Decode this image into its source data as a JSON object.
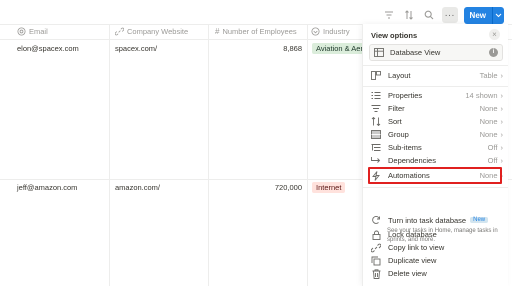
{
  "toolbar": {
    "filter_icon": "filter-icon",
    "sort_icon": "sort-icon",
    "search_icon": "search-icon",
    "more_label": "···",
    "new_label": "New"
  },
  "table": {
    "columns": [
      {
        "icon": "at-icon",
        "label": "Email"
      },
      {
        "icon": "link-icon",
        "label": "Company Website"
      },
      {
        "icon": "hash-icon",
        "label": "Number of Employees"
      },
      {
        "icon": "select-icon",
        "label": "Industry"
      }
    ],
    "rows": [
      {
        "email": "elon@spacex.com",
        "website": "spacex.com/",
        "employees": "8,868",
        "industry": "Aviation & Aeros"
      },
      {
        "email": "jeff@amazon.com",
        "website": "amazon.com/",
        "employees": "720,000",
        "industry": "Internet"
      }
    ]
  },
  "colors": {
    "accent": "#2383e2",
    "tag_green_bg": "#dbeddb",
    "tag_red_bg": "#ffe2dd",
    "highlight": "#e0201f"
  },
  "panel": {
    "title": "View options",
    "close_label": "×",
    "db_name": "Database View",
    "layout_label": "Layout",
    "layout_value": "Table",
    "items": [
      {
        "icon": "list-icon",
        "label": "Properties",
        "value": "14 shown"
      },
      {
        "icon": "filter-icon",
        "label": "Filter",
        "value": "None"
      },
      {
        "icon": "sort-icon",
        "label": "Sort",
        "value": "None"
      },
      {
        "icon": "group-icon",
        "label": "Group",
        "value": "None"
      },
      {
        "icon": "sub-items-icon",
        "label": "Sub-items",
        "value": "Off"
      },
      {
        "icon": "dependencies-icon",
        "label": "Dependencies",
        "value": "Off"
      },
      {
        "icon": "bolt-icon",
        "label": "Automations",
        "value": "None"
      }
    ],
    "task_title": "Turn into task database",
    "task_badge": "New",
    "task_desc": "See your tasks in Home, manage tasks in sprints, and more.",
    "actions": [
      {
        "icon": "lock-icon",
        "label": "Lock database"
      },
      {
        "icon": "link-icon",
        "label": "Copy link to view"
      },
      {
        "icon": "duplicate-icon",
        "label": "Duplicate view"
      },
      {
        "icon": "trash-icon",
        "label": "Delete view"
      }
    ]
  }
}
